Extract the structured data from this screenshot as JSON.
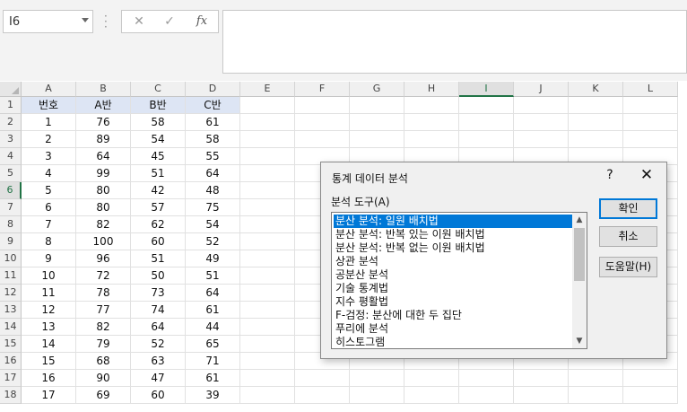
{
  "name_box": {
    "value": "I6"
  },
  "formula_bar": {
    "cancel_glyph": "✕",
    "enter_glyph": "✓",
    "fx_label": "fx",
    "value": ""
  },
  "columns": [
    "A",
    "B",
    "C",
    "D",
    "E",
    "F",
    "G",
    "H",
    "I",
    "J",
    "K",
    "L"
  ],
  "selected_column": "I",
  "selected_row": "6",
  "rows": [
    "1",
    "2",
    "3",
    "4",
    "5",
    "6",
    "7",
    "8",
    "9",
    "10",
    "11",
    "12",
    "13",
    "14",
    "15",
    "16",
    "17",
    "18"
  ],
  "table": {
    "headers": [
      "번호",
      "A반",
      "B반",
      "C반"
    ],
    "data": [
      [
        "1",
        "76",
        "58",
        "61"
      ],
      [
        "2",
        "89",
        "54",
        "58"
      ],
      [
        "3",
        "64",
        "45",
        "55"
      ],
      [
        "4",
        "99",
        "51",
        "64"
      ],
      [
        "5",
        "80",
        "42",
        "48"
      ],
      [
        "6",
        "80",
        "57",
        "75"
      ],
      [
        "7",
        "82",
        "62",
        "54"
      ],
      [
        "8",
        "100",
        "60",
        "52"
      ],
      [
        "9",
        "96",
        "51",
        "49"
      ],
      [
        "10",
        "72",
        "50",
        "51"
      ],
      [
        "11",
        "78",
        "73",
        "64"
      ],
      [
        "12",
        "77",
        "74",
        "61"
      ],
      [
        "13",
        "82",
        "64",
        "44"
      ],
      [
        "14",
        "79",
        "52",
        "65"
      ],
      [
        "15",
        "68",
        "63",
        "71"
      ],
      [
        "16",
        "90",
        "47",
        "61"
      ],
      [
        "17",
        "69",
        "60",
        "39"
      ]
    ]
  },
  "dialog": {
    "title": "통계 데이터 분석",
    "help_glyph": "?",
    "close_glyph": "✕",
    "list_label": "분석 도구(A)",
    "items": [
      "분산 분석: 일원 배치법",
      "분산 분석: 반복 있는 이원 배치법",
      "분산 분석: 반복 없는 이원 배치법",
      "상관 분석",
      "공분산 분석",
      "기술 통계법",
      "지수 평활법",
      "F-검정: 분산에 대한 두 집단",
      "푸리에 분석",
      "히스토그램"
    ],
    "selected_index": 0,
    "scroll_up_glyph": "▲",
    "scroll_down_glyph": "▼",
    "buttons": {
      "ok": "확인",
      "cancel": "취소",
      "help": "도움말(H)"
    }
  },
  "colors": {
    "accent_green": "#217346",
    "selection_blue": "#0078d7",
    "header_fill": "#dde5f4"
  }
}
